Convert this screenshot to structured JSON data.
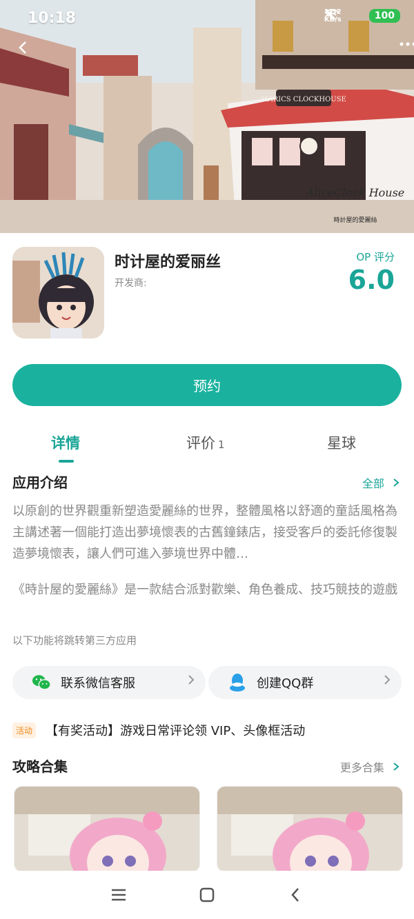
{
  "status": {
    "time": "10:18",
    "net_speed_value": "1.32",
    "net_speed_unit": "KB/s",
    "battery": "100"
  },
  "hero": {
    "logo_text": "AliceClock House",
    "logo_sub": "時計屋的愛麗絲",
    "shop_sign": "MARICS CLOCKHOUSE"
  },
  "app": {
    "name": "时计屋的爱丽丝",
    "developer_label": "开发商:",
    "score_label": "OP 评分",
    "score_value": "6.0"
  },
  "actions": {
    "reserve_label": "预约"
  },
  "tabs": [
    {
      "label": "详情",
      "active": true
    },
    {
      "label": "评价",
      "count": "1"
    },
    {
      "label": "星球"
    }
  ],
  "intro": {
    "title": "应用介绍",
    "all_label": "全部",
    "paragraph1": "以原創的世界觀重新塑造愛麗絲的世界，整體風格以舒適的童話風格為主講述著一個能打造出夢境懷表的古舊鐘錶店，接受客戶的委託修復製造夢境懷表，讓人們可進入夢境世界中體…",
    "paragraph2": "《時計屋的愛麗絲》是一款結合派對歡樂、角色養成、技巧競技的遊戲",
    "third_party_note": "以下功能将跳转第三方应用"
  },
  "links": {
    "wechat_label": "联系微信客服",
    "qq_label": "创建QQ群"
  },
  "activity": {
    "badge": "活动",
    "text": "【有奖活动】游戏日常评论领 VIP、头像框活动"
  },
  "guides": {
    "title": "攻略合集",
    "more_label": "更多合集"
  },
  "colors": {
    "accent": "#1aa597",
    "button": "#1ab29e",
    "activity_badge": "#f08a1c"
  }
}
